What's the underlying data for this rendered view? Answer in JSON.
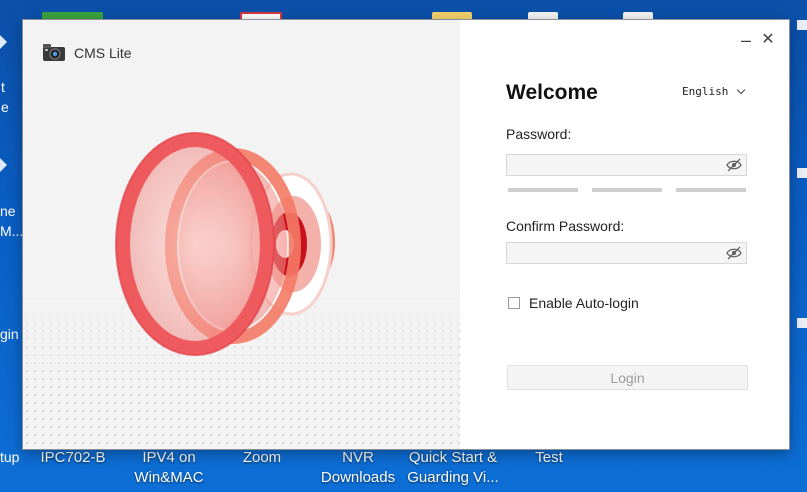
{
  "app": {
    "title": "CMS Lite",
    "welcome": "Welcome",
    "language": "English",
    "password_label": "Password:",
    "confirm_label": "Confirm Password:",
    "password_value": "",
    "confirm_value": "",
    "auto_login_label": "Enable Auto-login",
    "auto_login_checked": false,
    "login_label": "Login",
    "minimize_glyph": "–",
    "close_glyph": "✕",
    "accent_color": "#e8484a"
  },
  "desktop": {
    "edge_texts": [
      "t",
      "e",
      "ne",
      "M...",
      "gin",
      "tup"
    ],
    "icons": [
      {
        "line1": "IPC702-B",
        "line2": ""
      },
      {
        "line1": "IPV4 on",
        "line2": "Win&MAC"
      },
      {
        "line1": "Zoom",
        "line2": ""
      },
      {
        "line1": "NVR",
        "line2": "Downloads"
      },
      {
        "line1": "Quick Start &",
        "line2": "Guarding Vi..."
      },
      {
        "line1": "Test",
        "line2": ""
      }
    ]
  }
}
